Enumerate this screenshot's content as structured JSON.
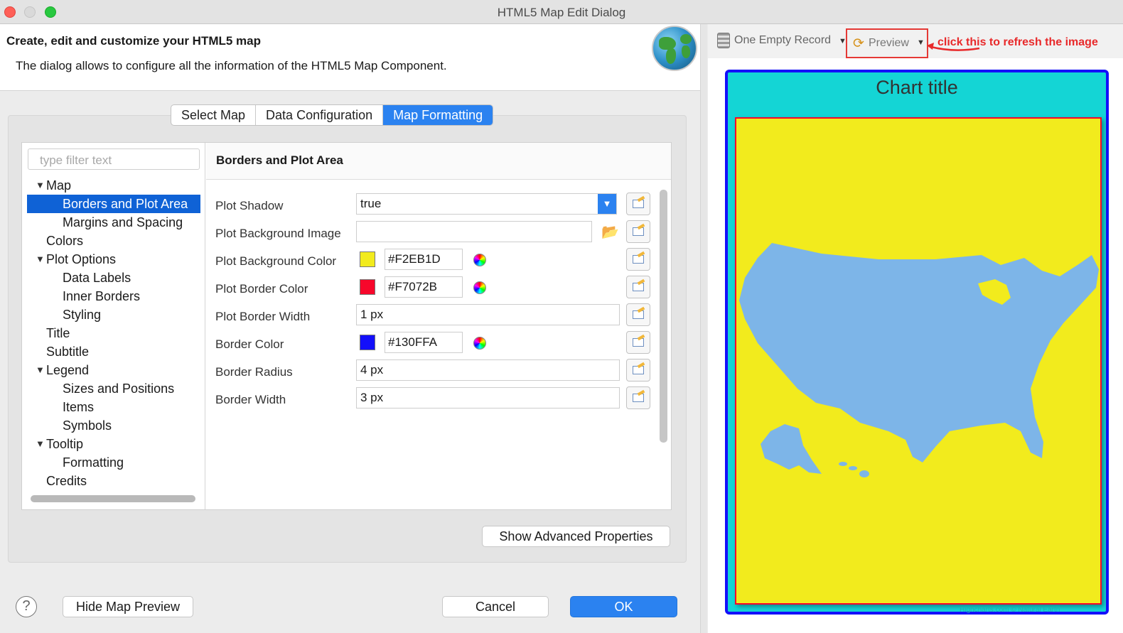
{
  "window": {
    "title": "HTML5 Map Edit Dialog"
  },
  "header": {
    "title": "Create, edit and customize your HTML5 map",
    "description": "The dialog allows to configure all the information of the HTML5 Map Component."
  },
  "tabs": [
    {
      "label": "Select Map",
      "active": false
    },
    {
      "label": "Data Configuration",
      "active": false
    },
    {
      "label": "Map Formatting",
      "active": true
    }
  ],
  "filter": {
    "placeholder": "type filter text"
  },
  "tree": [
    {
      "label": "Map",
      "level": 1,
      "expanded": true
    },
    {
      "label": "Borders and Plot Area",
      "level": 2,
      "selected": true
    },
    {
      "label": "Margins and Spacing",
      "level": 2
    },
    {
      "label": "Colors",
      "level": 1
    },
    {
      "label": "Plot Options",
      "level": 1,
      "expanded": true
    },
    {
      "label": "Data Labels",
      "level": 2
    },
    {
      "label": "Inner Borders",
      "level": 2
    },
    {
      "label": "Styling",
      "level": 2
    },
    {
      "label": "Title",
      "level": 1
    },
    {
      "label": "Subtitle",
      "level": 1
    },
    {
      "label": "Legend",
      "level": 1,
      "expanded": true
    },
    {
      "label": "Sizes and Positions",
      "level": 2
    },
    {
      "label": "Items",
      "level": 2
    },
    {
      "label": "Symbols",
      "level": 2
    },
    {
      "label": "Tooltip",
      "level": 1,
      "expanded": true
    },
    {
      "label": "Formatting",
      "level": 2
    },
    {
      "label": "Credits",
      "level": 1
    }
  ],
  "properties": {
    "section_title": "Borders and Plot Area",
    "plot_shadow": {
      "label": "Plot Shadow",
      "value": "true"
    },
    "plot_bg_image": {
      "label": "Plot Background Image",
      "value": ""
    },
    "plot_bg_color": {
      "label": "Plot Background Color",
      "value": "#F2EB1D",
      "color": "#F2EB1D"
    },
    "plot_border_color": {
      "label": "Plot Border Color",
      "value": "#F7072B",
      "color": "#F7072B"
    },
    "plot_border_width": {
      "label": "Plot Border Width",
      "value": "1 px"
    },
    "border_color": {
      "label": "Border Color",
      "value": "#130FFA",
      "color": "#130FFA"
    },
    "border_radius": {
      "label": "Border Radius",
      "value": "4 px"
    },
    "border_width": {
      "label": "Border Width",
      "value": "3 px"
    }
  },
  "buttons": {
    "advanced": "Show Advanced Properties",
    "hide_preview": "Hide Map Preview",
    "cancel": "Cancel",
    "ok": "OK",
    "help": "?"
  },
  "preview_toolbar": {
    "record": "One Empty Record",
    "preview": "Preview",
    "annotation": "click this to refresh the image",
    "annotation_color": "#E8292A"
  },
  "map_preview": {
    "title": "Chart title",
    "credits": "Highcharts.com © Natural Earth",
    "land_color": "#7DB5E8"
  }
}
